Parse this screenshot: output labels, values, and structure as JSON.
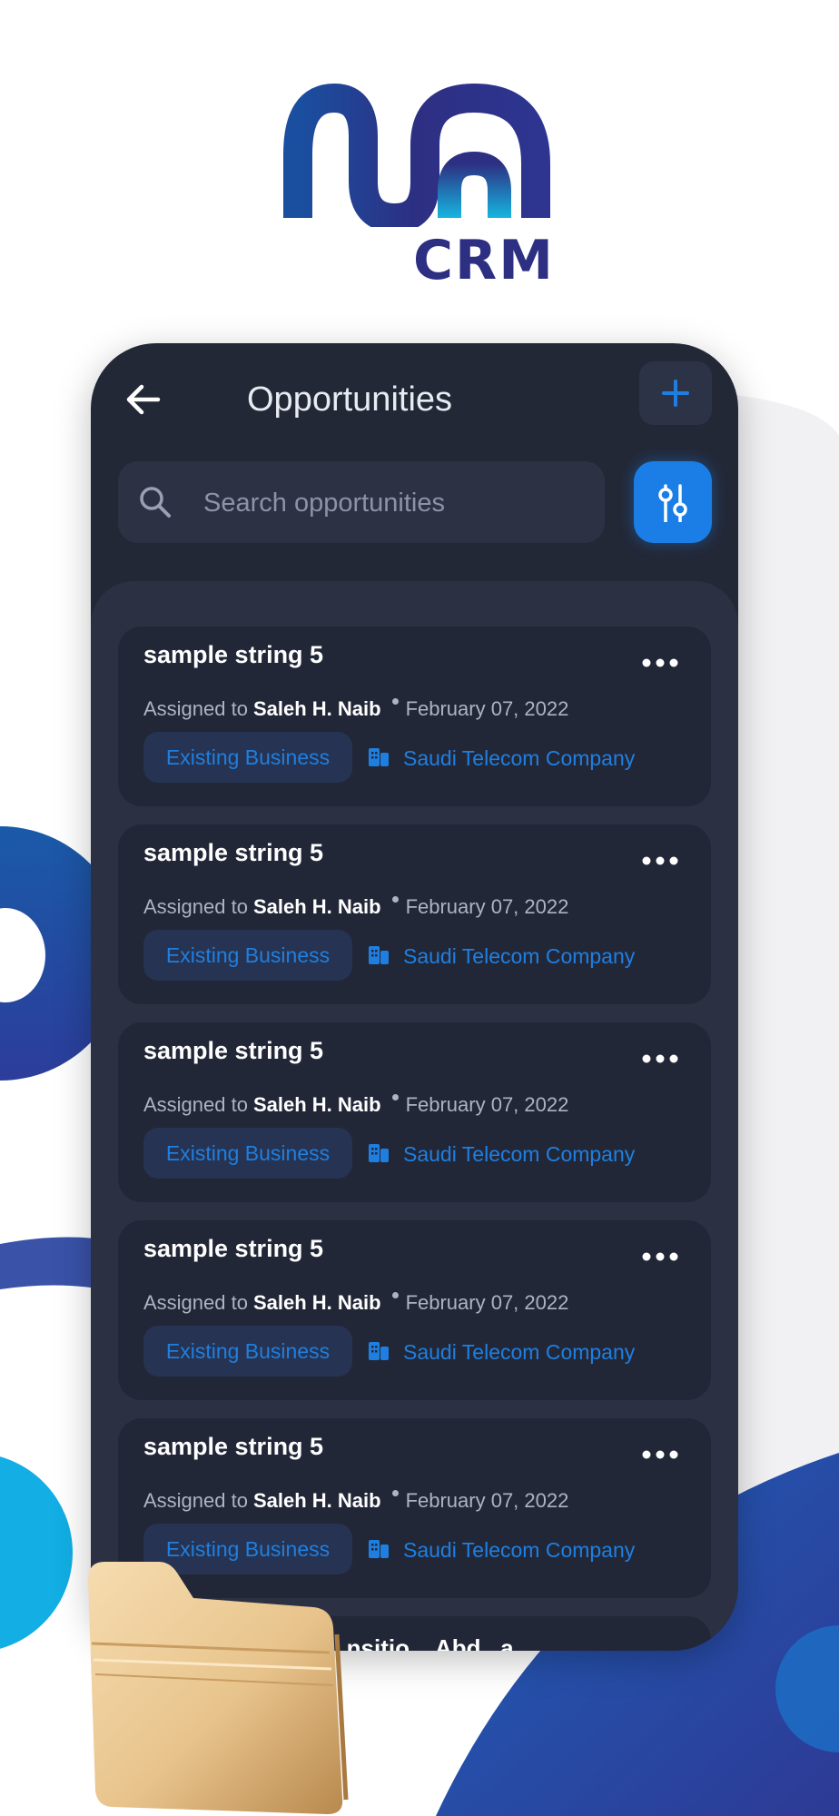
{
  "brand": {
    "logo_text": "CRM"
  },
  "colors": {
    "accent": "#1a7ee6",
    "phone_bg": "#232837",
    "panel_bg": "#2b3142",
    "card_bg": "#222738",
    "brand_navy": "#2d2f82",
    "brand_cyan": "#16b6e0"
  },
  "header": {
    "back_icon": "arrow-left-icon",
    "title": "Opportunities",
    "add_icon": "plus-icon"
  },
  "search": {
    "icon": "search-icon",
    "placeholder": "Search opportunities",
    "value": "",
    "filter_icon": "sliders-icon"
  },
  "opportunities": [
    {
      "title": "sample string 5",
      "assigned_label": "Assigned to",
      "assignee": "Saleh H. Naib",
      "date": "February 07, 2022",
      "type": "Existing Business",
      "company": "Saudi Telecom Company"
    },
    {
      "title": "sample string 5",
      "assigned_label": "Assigned to",
      "assignee": "Saleh H. Naib",
      "date": "February 07, 2022",
      "type": "Existing Business",
      "company": "Saudi Telecom Company"
    },
    {
      "title": "sample string 5",
      "assigned_label": "Assigned to",
      "assignee": "Saleh H. Naib",
      "date": "February 07, 2022",
      "type": "Existing Business",
      "company": "Saudi Telecom Company"
    },
    {
      "title": "sample string 5",
      "assigned_label": "Assigned to",
      "assignee": "Saleh H. Naib",
      "date": "February 07, 2022",
      "type": "Existing Business",
      "company": "Saudi Telecom Company"
    },
    {
      "title": "sample string 5",
      "assigned_label": "Assigned to",
      "assignee": "Saleh H. Naib",
      "date": "February 07, 2022",
      "type": "Existing Business",
      "company": "Saudi Telecom Company"
    }
  ],
  "partial_card_text": "...nsitio... Abd...a..."
}
